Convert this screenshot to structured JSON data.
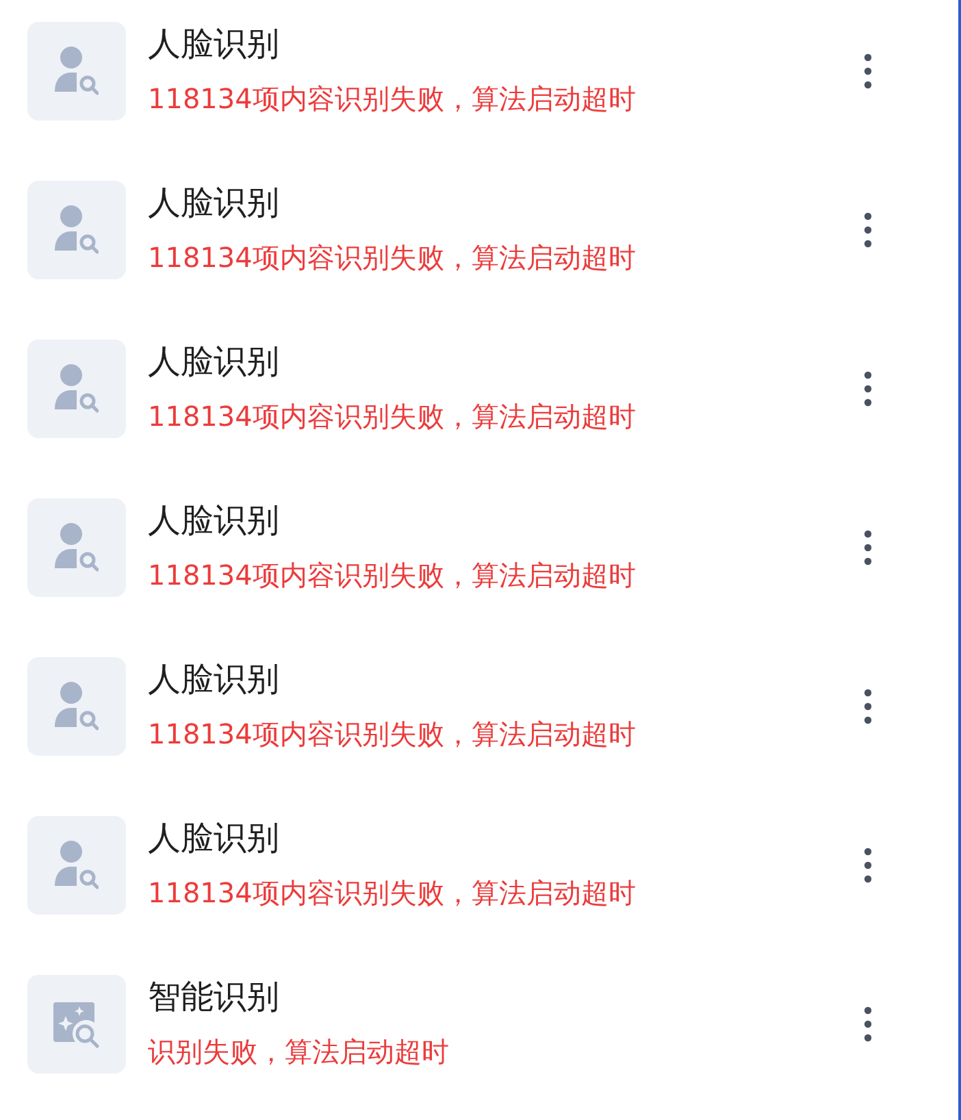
{
  "items": [
    {
      "kind": "face",
      "title": "人脸识别",
      "message": "118134项内容识别失败，算法启动超时"
    },
    {
      "kind": "face",
      "title": "人脸识别",
      "message": "118134项内容识别失败，算法启动超时"
    },
    {
      "kind": "face",
      "title": "人脸识别",
      "message": "118134项内容识别失败，算法启动超时"
    },
    {
      "kind": "face",
      "title": "人脸识别",
      "message": "118134项内容识别失败，算法启动超时"
    },
    {
      "kind": "face",
      "title": "人脸识别",
      "message": "118134项内容识别失败，算法启动超时"
    },
    {
      "kind": "face",
      "title": "人脸识别",
      "message": "118134项内容识别失败，算法启动超时"
    },
    {
      "kind": "smart",
      "title": "智能识别",
      "message": "识别失败，算法启动超时"
    }
  ]
}
